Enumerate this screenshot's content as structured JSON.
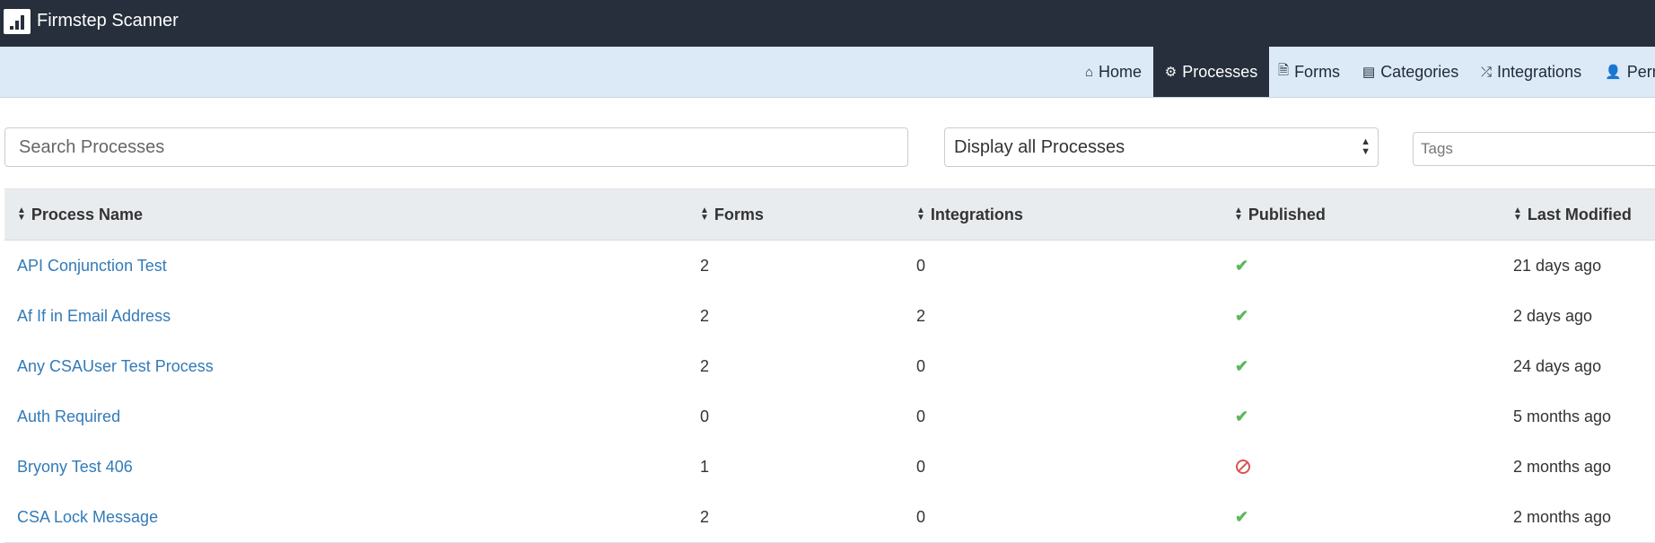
{
  "app": {
    "title": "Firmstep Scanner"
  },
  "nav": {
    "items": [
      {
        "label": "Home",
        "icon": "home-icon",
        "active": false
      },
      {
        "label": "Processes",
        "icon": "cogs-icon",
        "active": true
      },
      {
        "label": "Forms",
        "icon": "file-icon",
        "active": false
      },
      {
        "label": "Categories",
        "icon": "list-icon",
        "active": false
      },
      {
        "label": "Integrations",
        "icon": "random-icon",
        "active": false
      },
      {
        "label": "Perm",
        "icon": "user-icon",
        "active": false
      }
    ]
  },
  "toolbar": {
    "search_placeholder": "Search Processes",
    "filter_value": "Display all Processes",
    "tags_placeholder": "Tags"
  },
  "table": {
    "columns": [
      "Process Name",
      "Forms",
      "Integrations",
      "Published",
      "Last Modified"
    ],
    "rows": [
      {
        "name": "API Conjunction Test",
        "forms": "2",
        "integrations": "0",
        "published": true,
        "modified": "21 days ago"
      },
      {
        "name": "Af If in Email Address",
        "forms": "2",
        "integrations": "2",
        "published": true,
        "modified": "2 days ago"
      },
      {
        "name": "Any CSAUser Test Process",
        "forms": "2",
        "integrations": "0",
        "published": true,
        "modified": "24 days ago"
      },
      {
        "name": "Auth Required",
        "forms": "0",
        "integrations": "0",
        "published": true,
        "modified": "5 months ago"
      },
      {
        "name": "Bryony Test 406",
        "forms": "1",
        "integrations": "0",
        "published": false,
        "modified": "2 months ago"
      },
      {
        "name": "CSA Lock Message",
        "forms": "2",
        "integrations": "0",
        "published": true,
        "modified": "2 months ago"
      }
    ]
  },
  "colors": {
    "topbar": "#262f3b",
    "navbar": "#dce9f6",
    "link": "#337ab7",
    "published": "#5cb85c",
    "unpublished": "#d9534f"
  }
}
